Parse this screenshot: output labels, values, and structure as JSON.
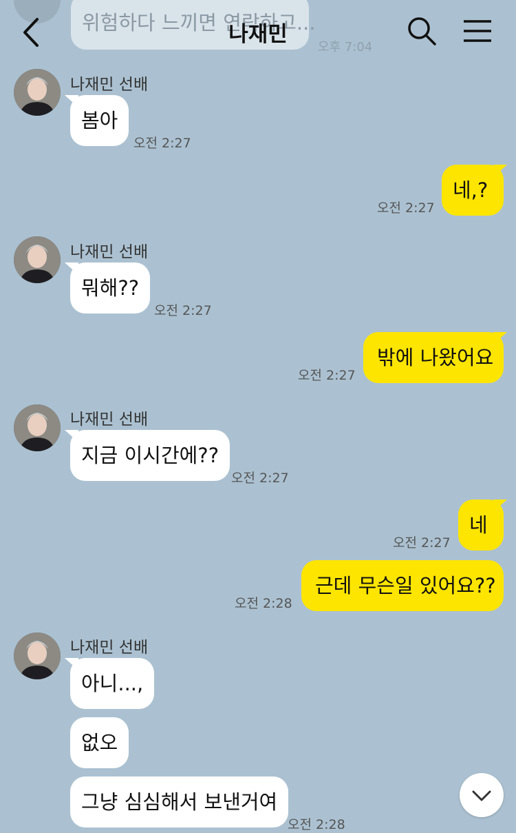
{
  "header": {
    "title": "나재민",
    "back_icon": "chevron-left-icon",
    "search_icon": "search-icon",
    "menu_icon": "hamburger-menu-icon"
  },
  "previous": {
    "text": "위험하다 느끼면 연락하고...",
    "time": "오후 7:04"
  },
  "sender_name": "나재민 선배",
  "messages": [
    {
      "from": "in",
      "text": "봄아",
      "time": "오전 2:27"
    },
    {
      "from": "out",
      "text": "네,?",
      "time": "오전 2:27"
    },
    {
      "from": "in",
      "text": "뭐해??",
      "time": "오전 2:27"
    },
    {
      "from": "out",
      "text": "밖에 나왔어요",
      "time": "오전 2:27"
    },
    {
      "from": "in",
      "text": "지금 이시간에??",
      "time": "오전 2:27"
    },
    {
      "from": "out",
      "text": "네",
      "time": "오전 2:27"
    },
    {
      "from": "out",
      "text": "근데 무슨일 있어요??",
      "time": "오전 2:28"
    },
    {
      "from": "in",
      "text": "아니...,",
      "time": ""
    },
    {
      "from": "in",
      "text": "없오",
      "time": ""
    },
    {
      "from": "in",
      "text": "그냥 심심해서 보낸거여",
      "time": "오전 2:28"
    }
  ],
  "colors": {
    "background": "#abc1d1",
    "outgoing": "#fee500",
    "incoming": "#ffffff"
  },
  "scroll_icon": "chevron-down-icon"
}
